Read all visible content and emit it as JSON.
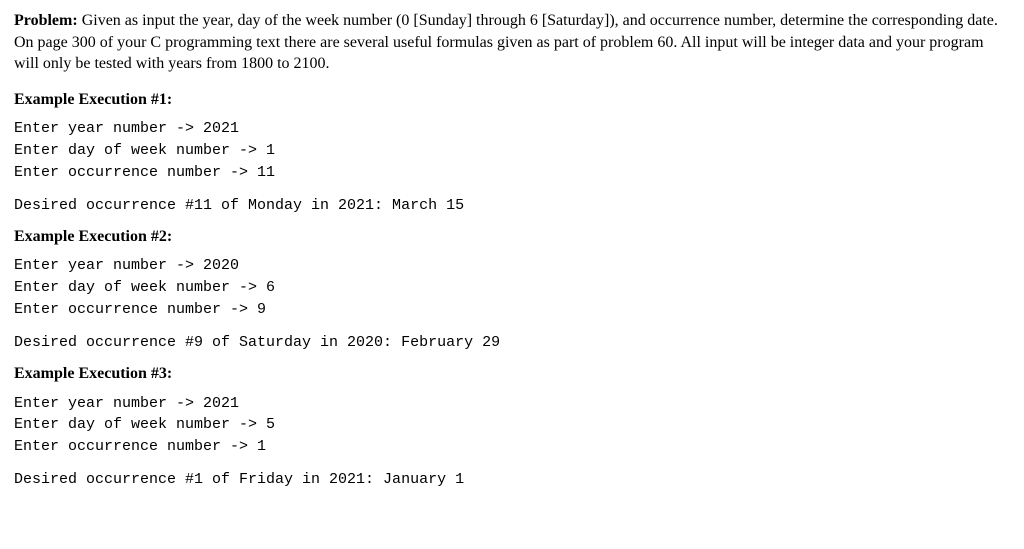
{
  "problem": {
    "label": "Problem:",
    "text": "Given as input the year, day of the week number (0 [Sunday] through 6 [Saturday]), and occurrence number, determine the corresponding date.  On page 300 of your C programming text there are several useful formulas given as part of problem 60.  All input will be integer data and your program will only be tested with years from 1800 to 2100."
  },
  "examples": [
    {
      "heading": "Example Execution #1:",
      "input_block": "Enter year number -> 2021\nEnter day of week number -> 1\nEnter occurrence number -> 11",
      "output_line": "Desired occurrence #11 of Monday in 2021: March 15"
    },
    {
      "heading": "Example Execution #2:",
      "input_block": "Enter year number -> 2020\nEnter day of week number -> 6\nEnter occurrence number -> 9",
      "output_line": "Desired occurrence #9 of Saturday in 2020: February 29"
    },
    {
      "heading": "Example Execution #3:",
      "input_block": "Enter year number -> 2021\nEnter day of week number -> 5\nEnter occurrence number -> 1",
      "output_line": "Desired occurrence #1 of Friday in 2021: January 1"
    }
  ]
}
